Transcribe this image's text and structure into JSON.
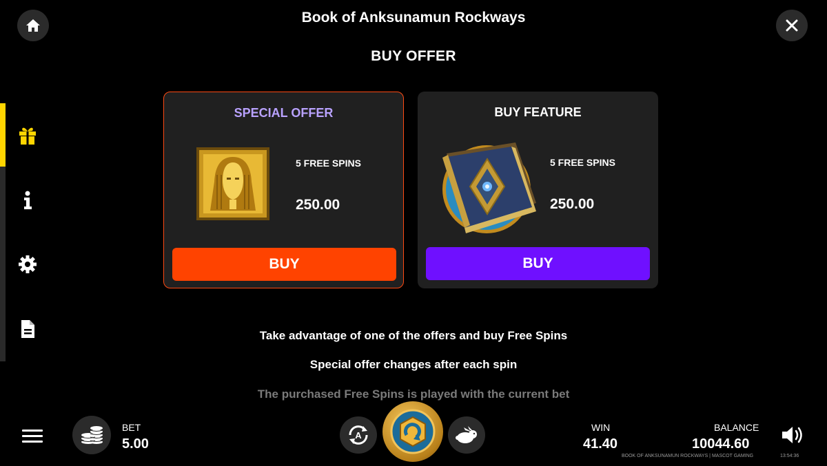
{
  "header": {
    "game_title": "Book of Anksunamun Rockways",
    "page_title": "BUY OFFER"
  },
  "side_menu": {
    "items": [
      {
        "icon": "gift-icon",
        "active": true
      },
      {
        "icon": "info-icon",
        "active": false
      },
      {
        "icon": "gear-icon",
        "active": false
      },
      {
        "icon": "document-icon",
        "active": false
      }
    ],
    "active_color": "#ffd500"
  },
  "offers": {
    "special": {
      "title": "SPECIAL OFFER",
      "spins": "5 FREE SPINS",
      "price": "250.00",
      "buy_label": "BUY",
      "title_color": "#b9a2ff",
      "button_color": "#ff4300"
    },
    "feature": {
      "title": "BUY FEATURE",
      "spins": "5 FREE SPINS",
      "price": "250.00",
      "buy_label": "BUY",
      "button_color": "#6f10ff"
    }
  },
  "info": {
    "line1": "Take advantage of one of the offers and buy Free Spins",
    "line2": "Special offer changes after each spin",
    "line3": "The purchased Free Spins is played with the current bet"
  },
  "bottom_bar": {
    "bet_label": "BET",
    "bet_value": "5.00",
    "win_label": "WIN",
    "win_value": "41.40",
    "balance_label": "BALANCE",
    "balance_value": "10044.60",
    "footer_text": "BOOK OF ANKSUNAMUN ROCKWAYS | MASCOT GAMING",
    "clock": "13:54:36"
  }
}
